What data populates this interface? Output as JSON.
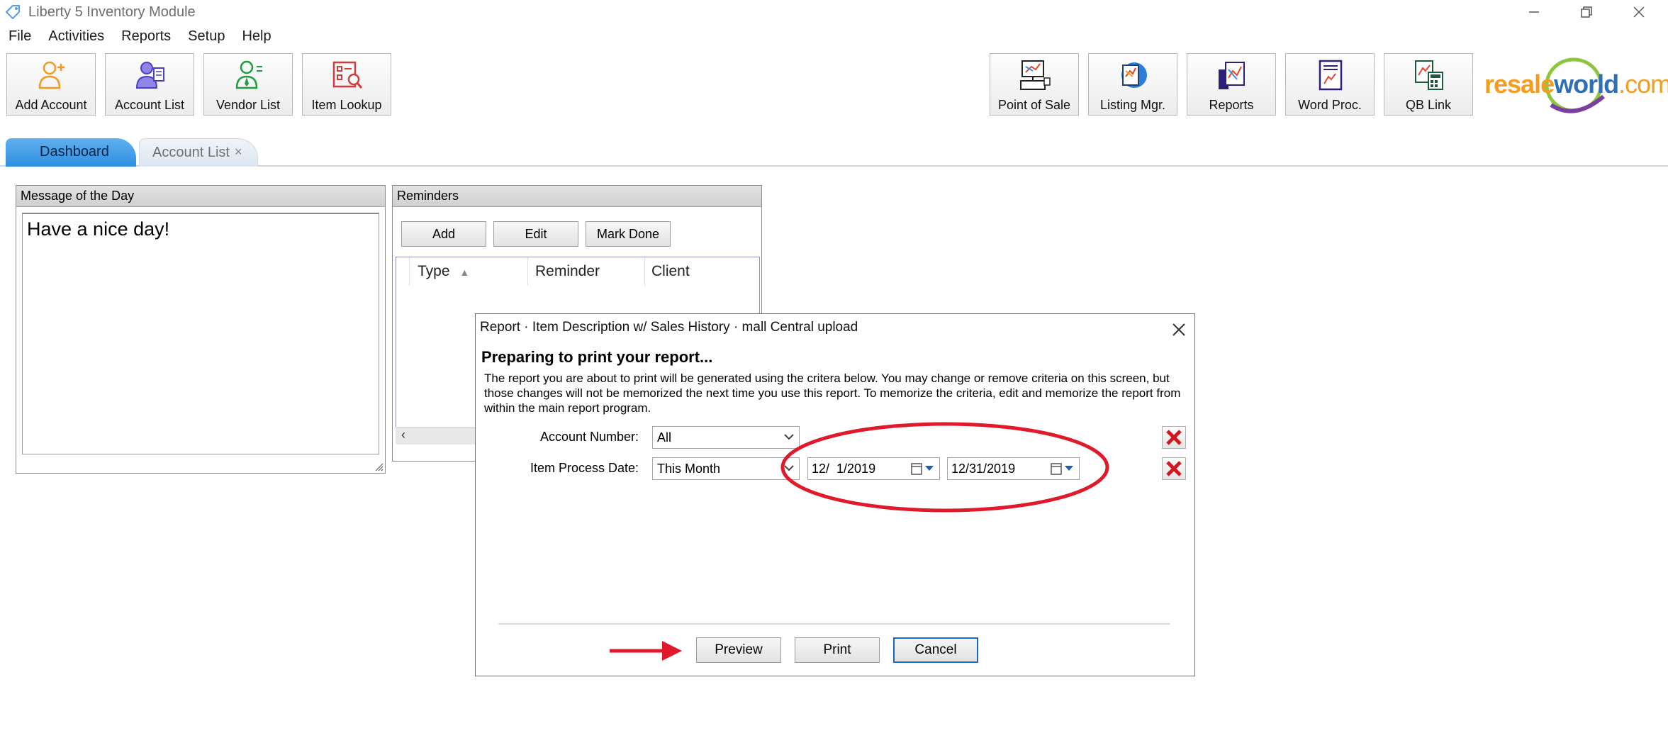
{
  "window": {
    "title": "Liberty 5 Inventory Module",
    "controls": [
      "minimize",
      "restore",
      "close"
    ]
  },
  "menu": [
    "File",
    "Activities",
    "Reports",
    "Setup",
    "Help"
  ],
  "toolbar_left": [
    {
      "label": "Add Account",
      "icon": "add-account-icon"
    },
    {
      "label": "Account List",
      "icon": "account-list-icon"
    },
    {
      "label": "Vendor List",
      "icon": "vendor-list-icon"
    },
    {
      "label": "Item Lookup",
      "icon": "item-lookup-icon"
    }
  ],
  "toolbar_right": [
    {
      "label": "Point of Sale",
      "icon": "point-of-sale-icon"
    },
    {
      "label": "Listing Mgr.",
      "icon": "listing-manager-icon"
    },
    {
      "label": "Reports",
      "icon": "reports-icon"
    },
    {
      "label": "Word Proc.",
      "icon": "word-processor-icon"
    },
    {
      "label": "QB Link",
      "icon": "qb-link-icon"
    }
  ],
  "logo": {
    "part1": "resale",
    "part2": "world",
    "part3": ".com",
    "tm": "™"
  },
  "tabs": [
    {
      "label": "Dashboard",
      "active": true
    },
    {
      "label": "Account List",
      "active": false,
      "close": "×"
    }
  ],
  "motd": {
    "header": "Message of the Day",
    "text": "Have a nice day!"
  },
  "reminders": {
    "header": "Reminders",
    "buttons": [
      "Add",
      "Edit",
      "Mark Done"
    ],
    "columns": [
      "Type",
      "Reminder",
      "Client"
    ]
  },
  "dialog": {
    "title": "Report · Item Description w/ Sales History · mall Central upload",
    "heading": "Preparing to print your report...",
    "description": "The report you are about to print will be generated using the critera below. You may change or remove criteria on this screen, but those changes will not be memorized the next time you use this report.  To memorize the criteria, edit and memorize the report from within the main report program.",
    "criteria": [
      {
        "label": "Account Number:",
        "value": "All"
      },
      {
        "label": "Item Process Date:",
        "value": "This Month",
        "from": "12/  1/2019",
        "to": "12/31/2019"
      }
    ],
    "buttons": {
      "preview": "Preview",
      "print": "Print",
      "cancel": "Cancel"
    }
  },
  "colors": {
    "annotation_red": "#e0192b",
    "tab_active": "#3a96e6",
    "delete_x": "#d4161f"
  }
}
